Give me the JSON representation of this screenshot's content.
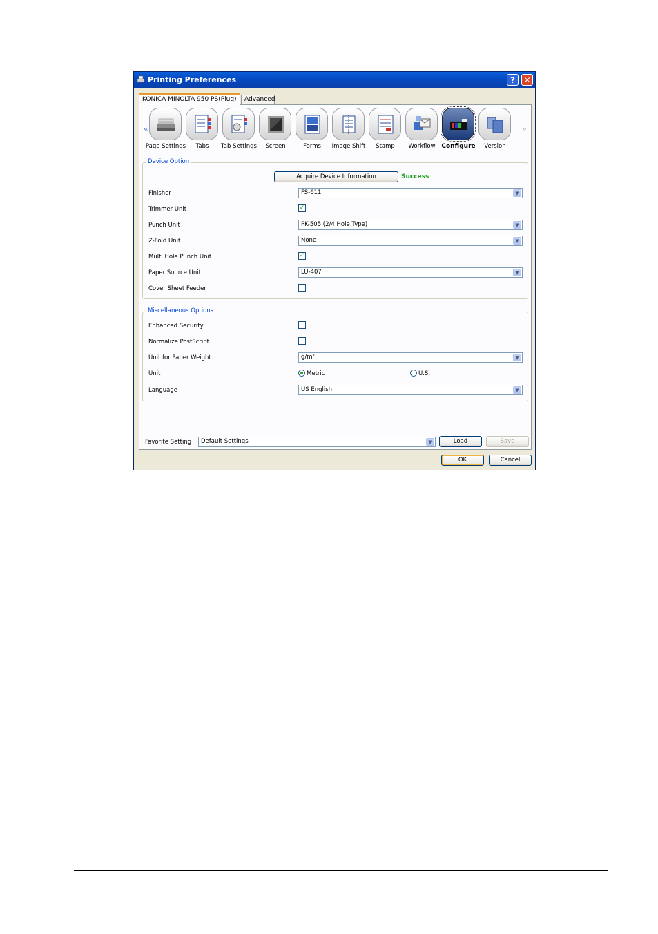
{
  "window": {
    "title": "Printing Preferences",
    "help_glyph": "?",
    "close_glyph": "✕"
  },
  "tabs": [
    {
      "label": "KONICA MINOLTA 950 PS(Plug)",
      "active": true
    },
    {
      "label": "Advanced",
      "active": false
    }
  ],
  "iconbar": {
    "left_arrow": "«",
    "right_arrow": "»",
    "items": [
      {
        "label": "Page Settings",
        "icon": "page-settings-icon"
      },
      {
        "label": "Tabs",
        "icon": "tabs-icon"
      },
      {
        "label": "Tab Settings",
        "icon": "tab-settings-icon"
      },
      {
        "label": "Screen",
        "icon": "screen-icon"
      },
      {
        "label": "Forms",
        "icon": "forms-icon"
      },
      {
        "label": "Image Shift",
        "icon": "image-shift-icon"
      },
      {
        "label": "Stamp",
        "icon": "stamp-icon"
      },
      {
        "label": "Workflow",
        "icon": "workflow-icon"
      },
      {
        "label": "Configure",
        "icon": "configure-icon",
        "selected": true
      },
      {
        "label": "Version",
        "icon": "version-icon"
      }
    ]
  },
  "device_option": {
    "title": "Device Option",
    "acquire_button": "Acquire Device Information",
    "status": "Success",
    "status_color": "#1fa11f",
    "finisher": {
      "label": "Finisher",
      "value": "FS-611"
    },
    "trimmer": {
      "label": "Trimmer Unit",
      "checked": true
    },
    "punch": {
      "label": "Punch Unit",
      "value": "PK-505 (2/4 Hole Type)"
    },
    "zfold": {
      "label": "Z-Fold Unit",
      "value": "None"
    },
    "multi_hole": {
      "label": "Multi Hole Punch Unit",
      "checked": true
    },
    "paper_source": {
      "label": "Paper Source Unit",
      "value": "LU-407"
    },
    "cover_sheet": {
      "label": "Cover Sheet Feeder",
      "checked": false
    }
  },
  "misc_options": {
    "title": "Miscellaneous Options",
    "enhanced_security": {
      "label": "Enhanced Security",
      "checked": false
    },
    "normalize_postscript": {
      "label": "Normalize PostScript",
      "checked": false
    },
    "paper_weight": {
      "label": "Unit for Paper Weight",
      "value": "g/m²"
    },
    "unit": {
      "label": "Unit",
      "option_metric": "Metric",
      "option_us": "U.S.",
      "selected": "Metric"
    },
    "language": {
      "label": "Language",
      "value": "US English"
    }
  },
  "favorite": {
    "label": "Favorite Setting",
    "value": "Default Settings",
    "load": "Load",
    "save": "Save"
  },
  "footer": {
    "ok": "OK",
    "cancel": "Cancel"
  },
  "colors": {
    "title_bar": "#0548c0",
    "group_title": "#0046d5",
    "accent_tab": "#e69a2a"
  }
}
